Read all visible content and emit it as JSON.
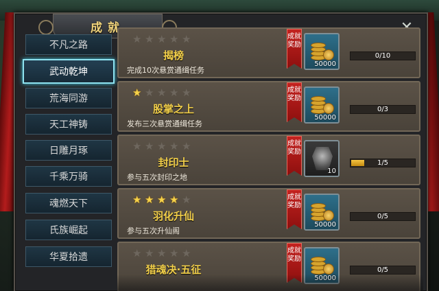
{
  "window": {
    "title": "成就"
  },
  "sidebar": {
    "items": [
      {
        "label": "不凡之路",
        "active": false
      },
      {
        "label": "武动乾坤",
        "active": true
      },
      {
        "label": "荒海同游",
        "active": false
      },
      {
        "label": "天工神铸",
        "active": false
      },
      {
        "label": "日雕月琢",
        "active": false
      },
      {
        "label": "千乘万骑",
        "active": false
      },
      {
        "label": "魂燃天下",
        "active": false
      },
      {
        "label": "氏族崛起",
        "active": false
      },
      {
        "label": "华夏拾遗",
        "active": false
      }
    ]
  },
  "achievements": [
    {
      "name": "揭榜",
      "desc": "完成10次悬赏通缉任务",
      "stars": 0,
      "reward_label": "成就奖励",
      "reward_icon": "gold-coins-icon",
      "reward_qty": "50000",
      "progress_text": "0/10",
      "progress": 0.0
    },
    {
      "name": "股掌之上",
      "desc": "发布三次悬赏通缉任务",
      "stars": 1,
      "reward_label": "成就奖励",
      "reward_icon": "gold-coins-icon",
      "reward_qty": "50000",
      "progress_text": "0/3",
      "progress": 0.0
    },
    {
      "name": "封印士",
      "desc": "参与五次封印之地",
      "stars": 0,
      "reward_label": "成就奖励",
      "reward_icon": "armor-icon",
      "reward_qty": "10",
      "progress_text": "1/5",
      "progress": 0.2
    },
    {
      "name": "羽化升仙",
      "desc": "参与五次升仙阁",
      "stars": 4,
      "reward_label": "成就奖励",
      "reward_icon": "gold-coins-icon",
      "reward_qty": "50000",
      "progress_text": "0/5",
      "progress": 0.0
    },
    {
      "name": "猎魂决·五征",
      "desc": "",
      "stars": 0,
      "reward_label": "成就奖励",
      "reward_icon": "gold-coins-icon",
      "reward_qty": "50000",
      "progress_text": "0/5",
      "progress": 0.0
    }
  ],
  "colors": {
    "accent": "#f2cf4a",
    "active_border": "#8fe3f0",
    "reward_tag": "#c4221f"
  }
}
